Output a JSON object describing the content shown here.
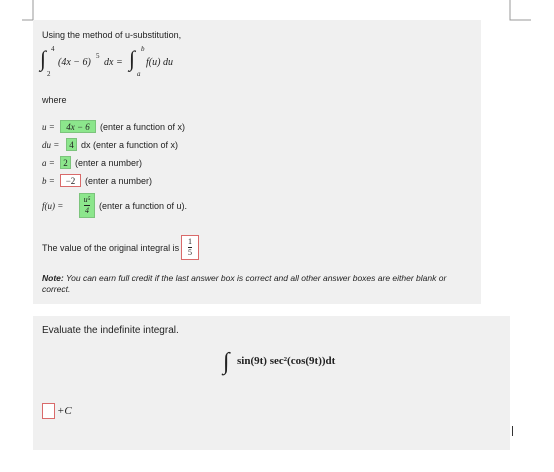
{
  "q1": {
    "intro": "Using the method of u-substitution,",
    "integral_left": "∫",
    "lower_left": "2",
    "upper_left": "4",
    "integrand_left": "(4x − 6)",
    "power_left": "5",
    "dx": "dx =",
    "integral_right": "∫",
    "lower_right": "a",
    "upper_right": "b",
    "integrand_right": "f(u) du",
    "where": "where",
    "u_label": "u =",
    "u_value": "4x − 6",
    "u_hint": "(enter a function of x)",
    "du_label": "du =",
    "du_value": "4",
    "du_hint": "dx (enter a function of x)",
    "a_label": "a =",
    "a_value": "2",
    "a_hint": "(enter a number)",
    "b_label": "b =",
    "b_value": "−2",
    "b_hint": "(enter a number)",
    "f_label": "f(u) =",
    "f_num": "u⁵",
    "f_den": "4",
    "f_hint": "(enter a function of u).",
    "orig_text": "The value of the original integral is",
    "orig_num": "1",
    "orig_den": "5",
    "note_label": "Note:",
    "note_text": " You can earn full credit if the last answer box is correct and all other answer boxes are either blank or correct."
  },
  "q2": {
    "prompt": "Evaluate the indefinite integral.",
    "integral_sign": "∫",
    "expression": "sin(9t) sec²(cos(9t))dt",
    "plus_c": "+C"
  },
  "colors": {
    "correct": "#8ce68c",
    "incorrect_border": "#d96a6a",
    "panel": "#f0f0f0"
  }
}
